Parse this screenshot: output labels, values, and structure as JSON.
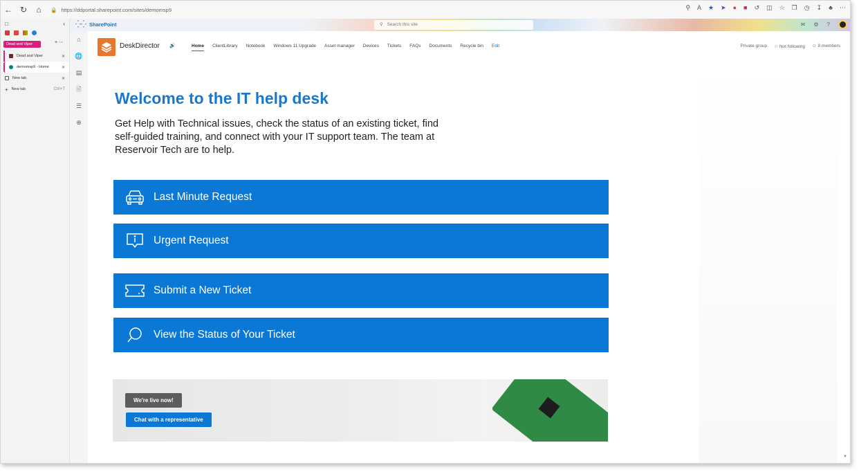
{
  "browser": {
    "url": "https://ddportal.sharepoint.com/sites/demomsp9"
  },
  "vertical_tabs": {
    "group_label": "Dead and Viper",
    "tabs": [
      {
        "label": "Dead and Viper"
      },
      {
        "label": "demomsp9 - Home"
      },
      {
        "label": "New tab"
      }
    ],
    "new_tab_label": "New tab",
    "new_tab_shortcut": "Ctrl+T"
  },
  "suitebar": {
    "app_name": "SharePoint",
    "search_placeholder": "Search this site"
  },
  "site": {
    "name": "DeskDirector",
    "nav": [
      "Home",
      "ClientLibrary",
      "Notebook",
      "Windows 11 Upgrade",
      "Asset manager",
      "Devices",
      "Tickets",
      "FAQs",
      "Documents",
      "Recycle bin",
      "Edit"
    ],
    "privacy": "Private group",
    "follow": "Not following",
    "members": "8 members"
  },
  "main": {
    "title": "Welcome to the IT help desk",
    "intro": "Get Help with Technical issues, check the status of an existing ticket, find self-guided training, and connect with your IT support team. The team at Reservoir Tech are to help.",
    "actions": [
      {
        "label": "Last Minute Request",
        "icon": "car-icon"
      },
      {
        "label": "Urgent Request",
        "icon": "info-bubble-icon"
      },
      {
        "label": "Submit a New Ticket",
        "icon": "ticket-icon"
      },
      {
        "label": "View the Status of Your Ticket",
        "icon": "search-icon"
      }
    ],
    "banner": {
      "live_label": "We're live now!",
      "chat_label": "Chat with a representative"
    }
  },
  "colors": {
    "accent": "#0b78d6",
    "title": "#1b78c8",
    "tab_group": "#d61f7c",
    "logo": "#e8772e"
  }
}
